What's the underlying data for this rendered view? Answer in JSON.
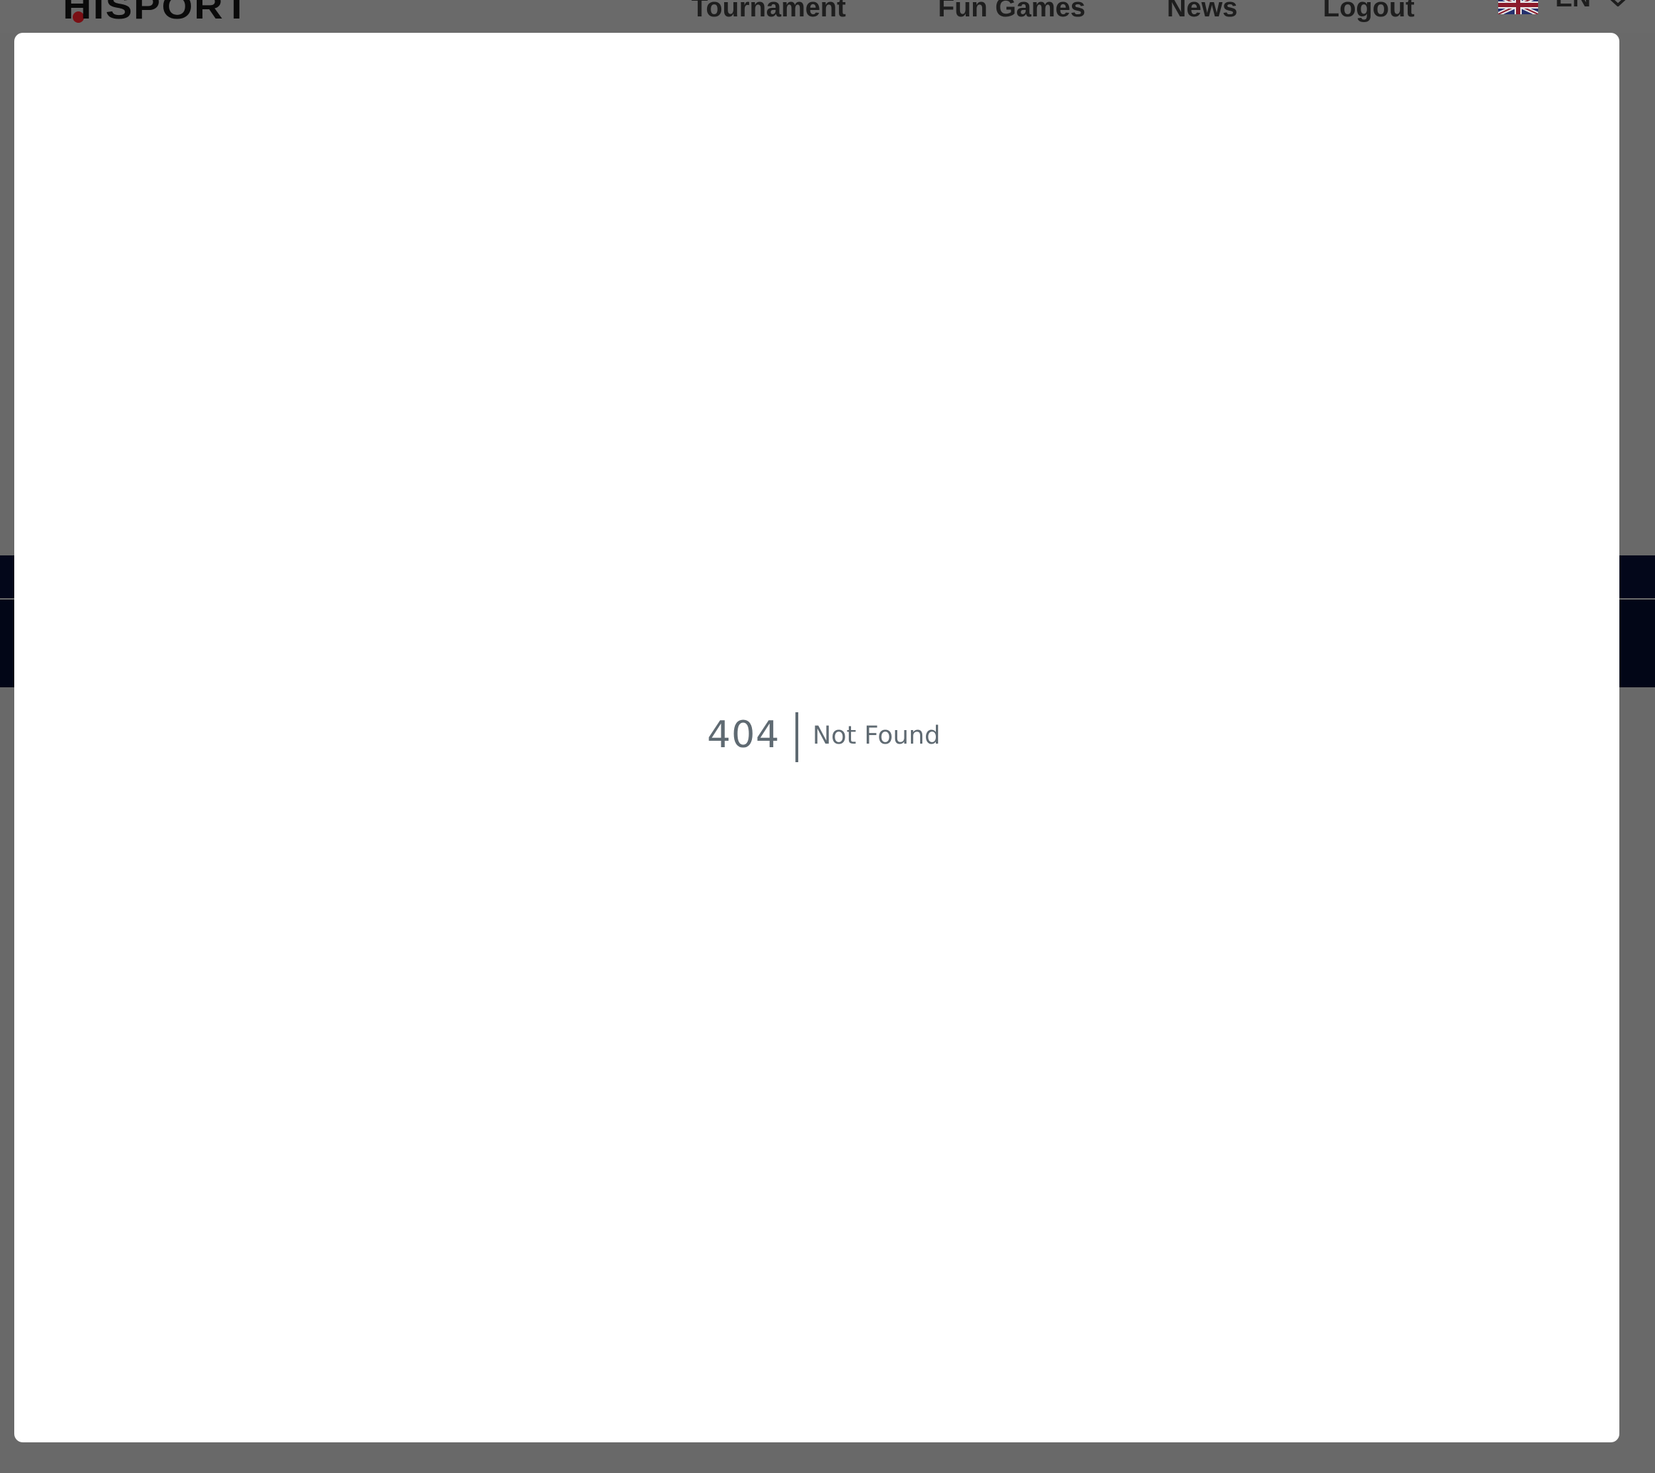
{
  "header": {
    "logo_text": "HISPORT",
    "nav": [
      {
        "label": "Tournament"
      },
      {
        "label": "Fun Games"
      },
      {
        "label": "News"
      },
      {
        "label": "Logout"
      }
    ],
    "language": {
      "code": "EN",
      "flag_icon": "uk-flag-icon",
      "dropdown_icon": "chevron-down-icon"
    }
  },
  "modal": {
    "error_code": "404",
    "error_message": "Not Found"
  },
  "colors": {
    "overlay": "#696969",
    "modal_bg": "#ffffff",
    "error_text": "#5f6a72",
    "dark_band": "#020617",
    "logo_accent": "#7a0f14"
  }
}
